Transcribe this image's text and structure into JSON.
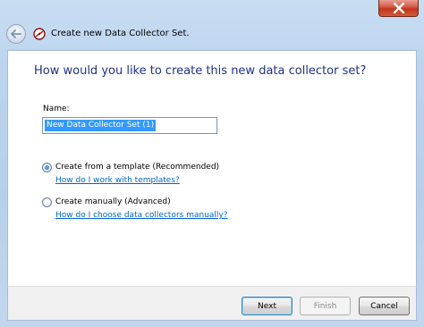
{
  "window": {
    "title": "Create new Data Collector Set."
  },
  "titlebar": {
    "close_icon": "close-icon"
  },
  "wizard": {
    "heading": "How would you like to create this new data collector set?",
    "name_label": "Name:",
    "name_value": "New Data Collector Set (1)",
    "options": [
      {
        "label": "Create from a template (Recommended)",
        "selected": true,
        "help_link": "How do I work with templates?"
      },
      {
        "label": "Create manually (Advanced)",
        "selected": false,
        "help_link": "How do I choose data collectors manually?"
      }
    ]
  },
  "buttons": {
    "next": "Next",
    "finish": "Finish",
    "cancel": "Cancel"
  },
  "colors": {
    "heading": "#1e3287",
    "link": "#0066cc",
    "selection": "#3399ff"
  }
}
